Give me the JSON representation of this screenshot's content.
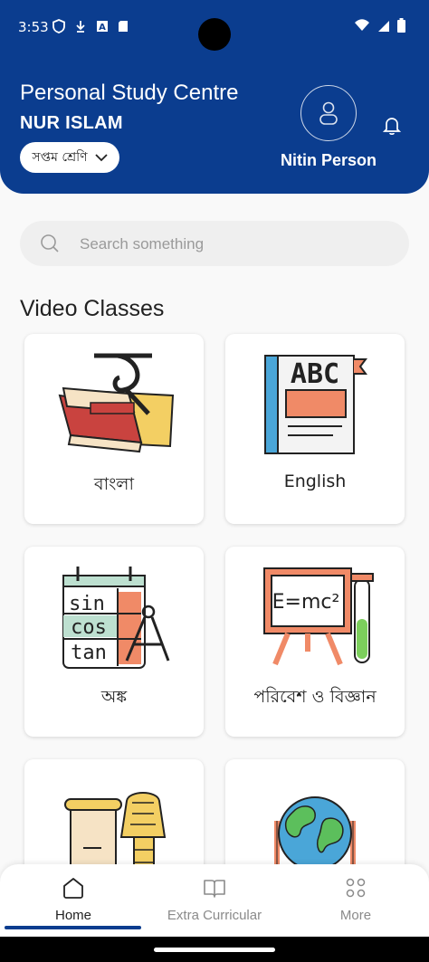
{
  "status_bar": {
    "time": "3:53"
  },
  "header": {
    "title": "Personal Study Centre",
    "subtitle": "NUR ISLAM",
    "class_select": "সপ্তম শ্রেণি",
    "user_name": "Nitin Person"
  },
  "search": {
    "placeholder": "Search something"
  },
  "section_title": "Video Classes",
  "cards": [
    {
      "label": "বাংলা",
      "icon": "bangla-book-icon"
    },
    {
      "label": "English",
      "icon": "abc-book-icon"
    },
    {
      "label": "অঙ্ক",
      "icon": "math-trig-icon"
    },
    {
      "label": "পরিবেশ ও বিজ্ঞান",
      "icon": "science-board-icon"
    },
    {
      "label": "",
      "icon": "history-pharaoh-icon"
    },
    {
      "label": "",
      "icon": "globe-icon"
    }
  ],
  "bottom_nav": [
    {
      "label": "Home",
      "active": true
    },
    {
      "label": "Extra Curricular",
      "active": false
    },
    {
      "label": "More",
      "active": false
    }
  ],
  "colors": {
    "primary": "#0b3d8f",
    "background": "#f9f9f9"
  }
}
